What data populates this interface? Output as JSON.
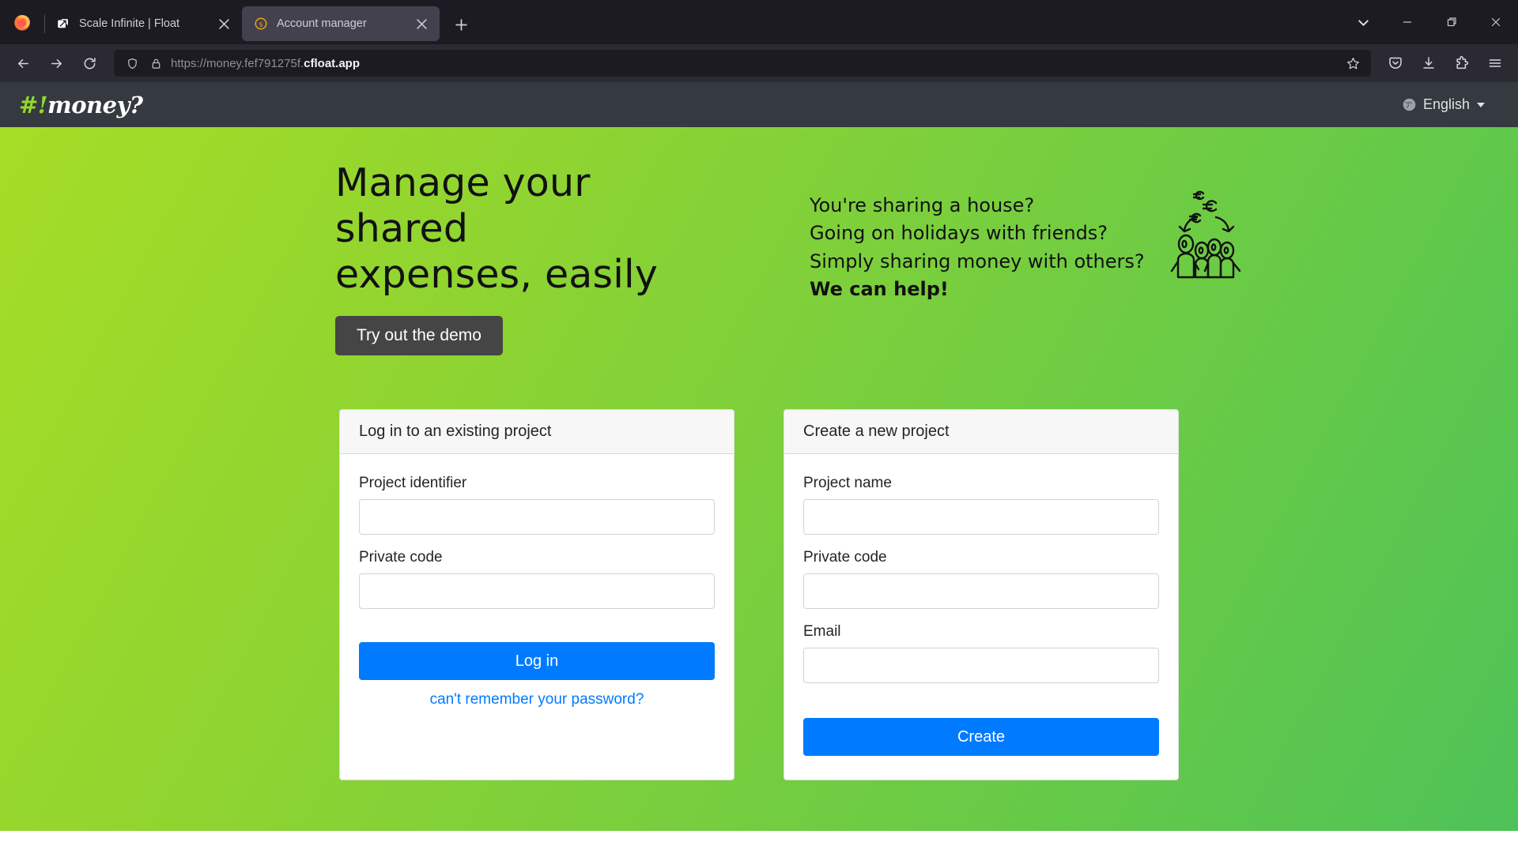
{
  "browser": {
    "tabs": [
      {
        "title": "Scale Infinite | Float",
        "favicon": "float-icon",
        "active": false
      },
      {
        "title": "Account manager",
        "favicon": "coin-icon",
        "active": true
      }
    ],
    "new_tab_label": "+",
    "nav": {
      "back_icon": "back-arrow-icon",
      "forward_icon": "forward-arrow-icon",
      "reload_icon": "reload-icon"
    },
    "url": {
      "prefix": "https://money.fef791275f.",
      "host": "cfloat.app",
      "shield_icon": "shield-icon",
      "lock_icon": "lock-icon",
      "bookmark_icon": "star-icon"
    },
    "toolbar_icons": [
      "pocket-icon",
      "download-icon",
      "extensions-icon",
      "menu-icon"
    ],
    "window_controls": [
      "tab-list-chevron-icon",
      "minimize-icon",
      "maximize-icon",
      "close-icon"
    ]
  },
  "app": {
    "brand_prefix": "#!",
    "brand_name": "money?",
    "language": {
      "label": "English",
      "icon": "globe-icon"
    }
  },
  "hero": {
    "headline": "Manage your shared\nexpenses, easily",
    "demo_button": "Try out the demo",
    "pitch": [
      "You're sharing a house?",
      "Going on holidays with friends?",
      "Simply sharing money with others?"
    ],
    "pitch_strong": "We can help!",
    "illustration": "people-with-euros-icon"
  },
  "login_card": {
    "title": "Log in to an existing project",
    "fields": [
      {
        "label": "Project identifier",
        "value": "",
        "placeholder": "",
        "type": "text"
      },
      {
        "label": "Private code",
        "value": "",
        "placeholder": "",
        "type": "password"
      }
    ],
    "submit_label": "Log in",
    "forgot_label": "can't remember your password?"
  },
  "create_card": {
    "title": "Create a new project",
    "fields": [
      {
        "label": "Project name",
        "value": "",
        "placeholder": "",
        "type": "text"
      },
      {
        "label": "Private code",
        "value": "",
        "placeholder": "",
        "type": "password"
      },
      {
        "label": "Email",
        "value": "",
        "placeholder": "",
        "type": "email"
      }
    ],
    "submit_label": "Create"
  },
  "colors": {
    "accent_blue": "#007bff",
    "brand_green": "#94d82d",
    "header_dark": "#343a40",
    "hero_gradient_start": "#a5dd26",
    "hero_gradient_end": "#4ec258",
    "demo_button": "#454545"
  }
}
